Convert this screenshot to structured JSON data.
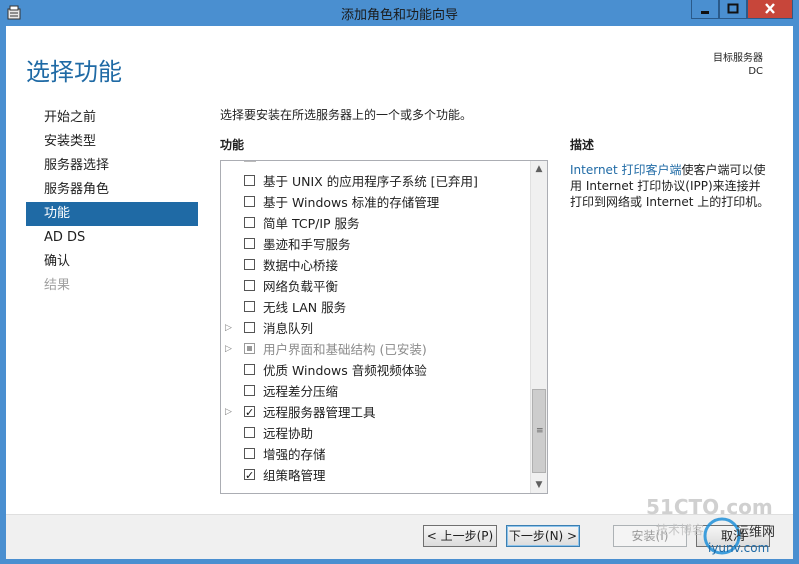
{
  "window": {
    "title": "添加角色和功能向导"
  },
  "page": {
    "title": "选择功能",
    "target_label": "目标服务器",
    "target_server": "DC"
  },
  "nav": {
    "items": [
      {
        "label": "开始之前",
        "state": "normal"
      },
      {
        "label": "安装类型",
        "state": "normal"
      },
      {
        "label": "服务器选择",
        "state": "normal"
      },
      {
        "label": "服务器角色",
        "state": "normal"
      },
      {
        "label": "功能",
        "state": "active"
      },
      {
        "label": "AD DS",
        "state": "normal"
      },
      {
        "label": "确认",
        "state": "normal"
      },
      {
        "label": "结果",
        "state": "disabled"
      }
    ]
  },
  "main": {
    "intro": "选择要安装在所选服务器上的一个或多个功能。",
    "features_header": "功能",
    "description_header": "描述",
    "description_link": "Internet 打印客户端",
    "description_text": "使客户端可以使用 Internet 打印协议(IPP)来连接并打印到网络或 Internet 上的打印机。",
    "features": [
      {
        "label": "基于 UNIX 的应用程序子系统 [已弃用]",
        "checked": false,
        "expandable": false,
        "installed": false
      },
      {
        "label": "基于 Windows 标准的存储管理",
        "checked": false,
        "expandable": false,
        "installed": false
      },
      {
        "label": "简单 TCP/IP 服务",
        "checked": false,
        "expandable": false,
        "installed": false
      },
      {
        "label": "墨迹和手写服务",
        "checked": false,
        "expandable": false,
        "installed": false
      },
      {
        "label": "数据中心桥接",
        "checked": false,
        "expandable": false,
        "installed": false
      },
      {
        "label": "网络负载平衡",
        "checked": false,
        "expandable": false,
        "installed": false
      },
      {
        "label": "无线 LAN 服务",
        "checked": false,
        "expandable": false,
        "installed": false
      },
      {
        "label": "消息队列",
        "checked": false,
        "expandable": true,
        "installed": false
      },
      {
        "label": "用户界面和基础结构 (已安装)",
        "checked": false,
        "expandable": true,
        "installed": true
      },
      {
        "label": "优质 Windows 音频视频体验",
        "checked": false,
        "expandable": false,
        "installed": false
      },
      {
        "label": "远程差分压缩",
        "checked": false,
        "expandable": false,
        "installed": false
      },
      {
        "label": "远程服务器管理工具",
        "checked": true,
        "expandable": true,
        "installed": false
      },
      {
        "label": "远程协助",
        "checked": false,
        "expandable": false,
        "installed": false
      },
      {
        "label": "增强的存储",
        "checked": false,
        "expandable": false,
        "installed": false
      },
      {
        "label": "组策略管理",
        "checked": true,
        "expandable": false,
        "installed": false
      }
    ]
  },
  "footer": {
    "prev_label": "< 上一步(P)",
    "next_label": "下一步(N) >",
    "install_label": "安装(I)",
    "cancel_label": "取消"
  },
  "watermark": {
    "line1": "51CTO.com",
    "line2": "技术博客",
    "line3": "运维网",
    "line4": "iyunv.com"
  },
  "colors": {
    "accent": "#1f6aa5",
    "titlebar": "#4a8fd0",
    "close": "#c7463a"
  }
}
